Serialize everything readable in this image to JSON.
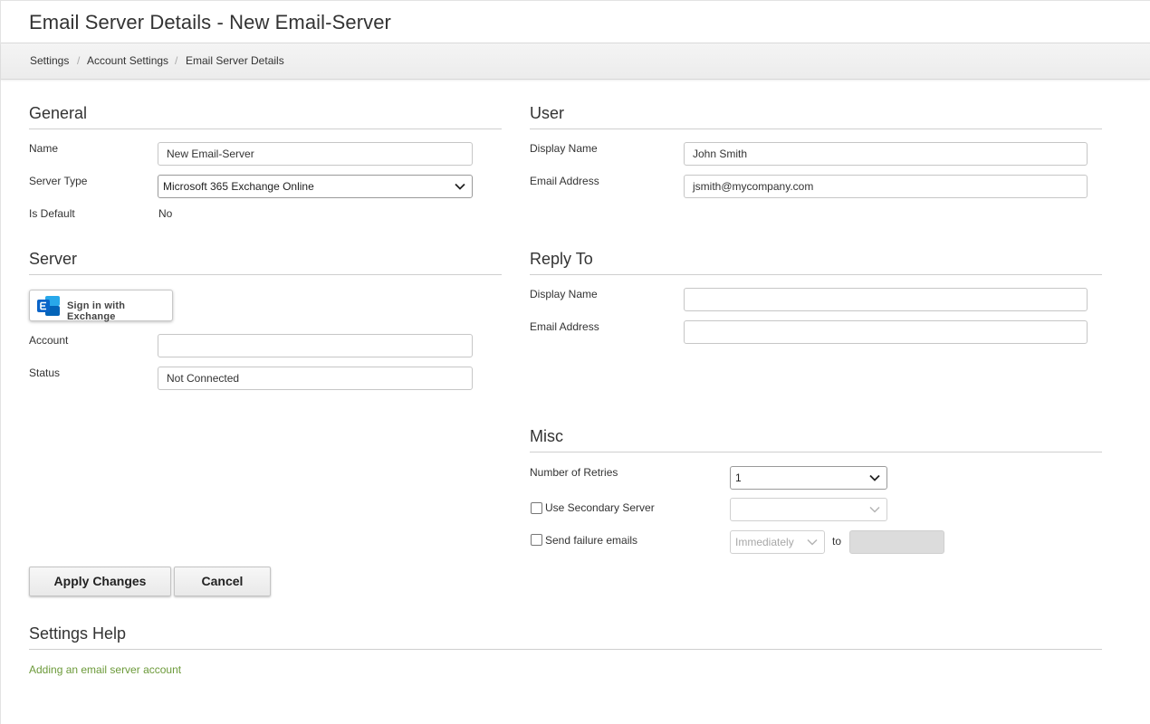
{
  "header": {
    "title": "Email Server Details - New Email-Server"
  },
  "breadcrumb": {
    "items": [
      "Settings",
      "Account Settings",
      "Email Server Details"
    ],
    "separator": "/"
  },
  "general": {
    "title": "General",
    "name_label": "Name",
    "name_value": "New Email-Server",
    "server_type_label": "Server Type",
    "server_type_value": "Microsoft 365 Exchange Online",
    "is_default_label": "Is Default",
    "is_default_value": "No"
  },
  "user": {
    "title": "User",
    "display_name_label": "Display Name",
    "display_name_value": "John Smith",
    "email_label": "Email Address",
    "email_value": "jsmith@mycompany.com"
  },
  "server": {
    "title": "Server",
    "sign_in_label": "Sign in with Exchange",
    "account_label": "Account",
    "account_value": "",
    "status_label": "Status",
    "status_value": "Not Connected"
  },
  "reply_to": {
    "title": "Reply To",
    "display_name_label": "Display Name",
    "display_name_value": "",
    "email_label": "Email Address",
    "email_value": ""
  },
  "misc": {
    "title": "Misc",
    "retries_label": "Number of Retries",
    "retries_value": "1",
    "secondary_label": "Use Secondary Server",
    "secondary_value": "",
    "failure_label": "Send failure emails",
    "failure_timing_value": "Immediately",
    "to_label": "to"
  },
  "actions": {
    "apply_label": "Apply Changes",
    "cancel_label": "Cancel"
  },
  "help": {
    "title": "Settings Help",
    "link_label": "Adding an email server account"
  },
  "colors": {
    "link": "#6c9a3a",
    "exchange_blue": "#0a64c8"
  }
}
